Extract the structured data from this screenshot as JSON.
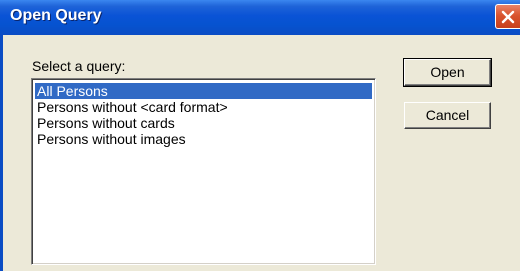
{
  "window": {
    "title": "Open Query"
  },
  "dialog": {
    "label": "Select a query:",
    "queries": [
      "All Persons",
      "Persons without <card format>",
      "Persons without cards",
      "Persons without images"
    ],
    "selected_index": 0
  },
  "buttons": {
    "open_label": "Open",
    "cancel_label": "Cancel"
  },
  "colors": {
    "title_bar": "#0a53d6",
    "selection": "#316ac5",
    "close_button": "#d9542f",
    "dialog_bg": "#ece9d8"
  },
  "icons": {
    "close": "close-icon"
  }
}
